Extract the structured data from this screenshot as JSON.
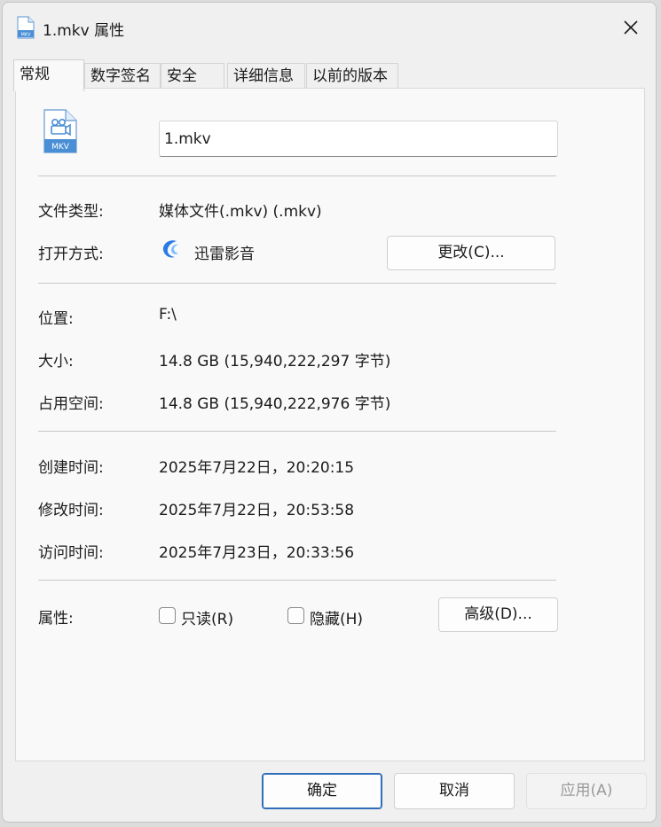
{
  "window": {
    "title": "1.mkv 属性",
    "icon": "mkv-file-icon",
    "close_icon": "close-icon"
  },
  "tabs": [
    {
      "label": "常规",
      "active": true
    },
    {
      "label": "数字签名",
      "active": false
    },
    {
      "label": "安全",
      "active": false
    },
    {
      "label": "详细信息",
      "active": false
    },
    {
      "label": "以前的版本",
      "active": false
    }
  ],
  "general": {
    "file_icon_text": "MKV",
    "filename": "1.mkv",
    "file_type": {
      "label": "文件类型:",
      "value": "媒体文件(.mkv) (.mkv)"
    },
    "opens_with": {
      "label": "打开方式:",
      "value": "迅雷影音",
      "change_button": "更改(C)..."
    },
    "location": {
      "label": "位置:",
      "value": "F:\\"
    },
    "size": {
      "label": "大小:",
      "value": "14.8 GB (15,940,222,297 字节)"
    },
    "size_on_disk": {
      "label": "占用空间:",
      "value": "14.8 GB (15,940,222,976 字节)"
    },
    "created": {
      "label": "创建时间:",
      "value": "2025年7月22日，20:20:15"
    },
    "modified": {
      "label": "修改时间:",
      "value": "2025年7月22日，20:53:58"
    },
    "accessed": {
      "label": "访问时间:",
      "value": "2025年7月23日，20:33:56"
    },
    "attributes": {
      "label": "属性:",
      "readonly": {
        "label": "只读(R)",
        "checked": false
      },
      "hidden": {
        "label": "隐藏(H)",
        "checked": false
      },
      "advanced_button": "高级(D)..."
    }
  },
  "footer": {
    "ok": "确定",
    "cancel": "取消",
    "apply": "应用(A)"
  },
  "colors": {
    "accent": "#2f6fba",
    "icon_blue": "#4a8fd6"
  }
}
